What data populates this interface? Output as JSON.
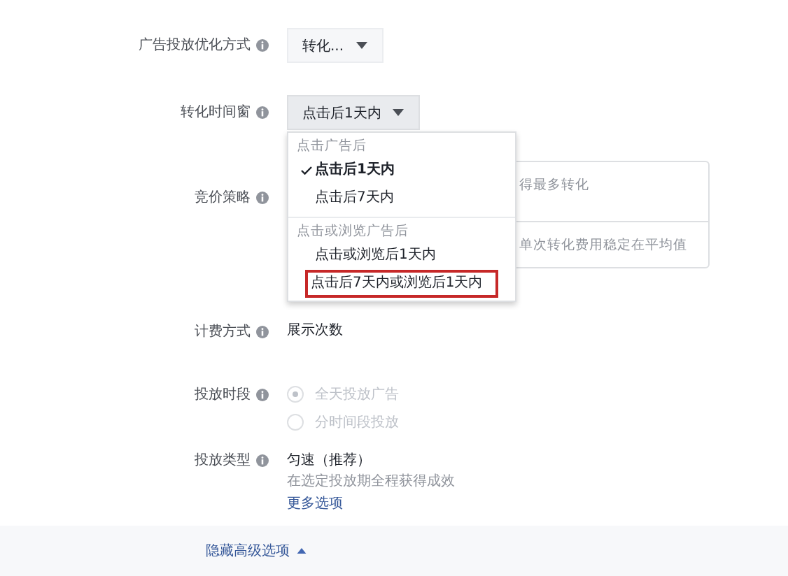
{
  "optimization": {
    "label": "广告投放优化方式",
    "value": "转化..."
  },
  "conversion_window": {
    "label": "转化时间窗",
    "value": "点击后1天内",
    "menu": {
      "groups": [
        {
          "heading": "点击广告后",
          "options": [
            {
              "label": "点击后1天内",
              "checked": true,
              "highlighted": false
            },
            {
              "label": "点击后7天内",
              "checked": false,
              "highlighted": false
            }
          ]
        },
        {
          "heading": "点击或浏览广告后",
          "options": [
            {
              "label": "点击或浏览后1天内",
              "checked": false,
              "highlighted": false
            },
            {
              "label": "点击后7天内或浏览后1天内",
              "checked": false,
              "highlighted": true
            }
          ]
        }
      ]
    }
  },
  "bid_strategy": {
    "label": "竞价策略",
    "options": [
      "得最多转化",
      "单次转化费用稳定在平均值"
    ]
  },
  "billing": {
    "label": "计费方式",
    "value": "展示次数"
  },
  "schedule": {
    "label": "投放时段",
    "disabled": true,
    "options": [
      {
        "label": "全天投放广告",
        "selected": true
      },
      {
        "label": "分时间段投放",
        "selected": false
      }
    ]
  },
  "delivery_type": {
    "label": "投放类型",
    "value": "匀速（推荐）",
    "description": "在选定投放期全程获得成效",
    "more_link": "更多选项"
  },
  "hide_link": "隐藏高级选项"
}
